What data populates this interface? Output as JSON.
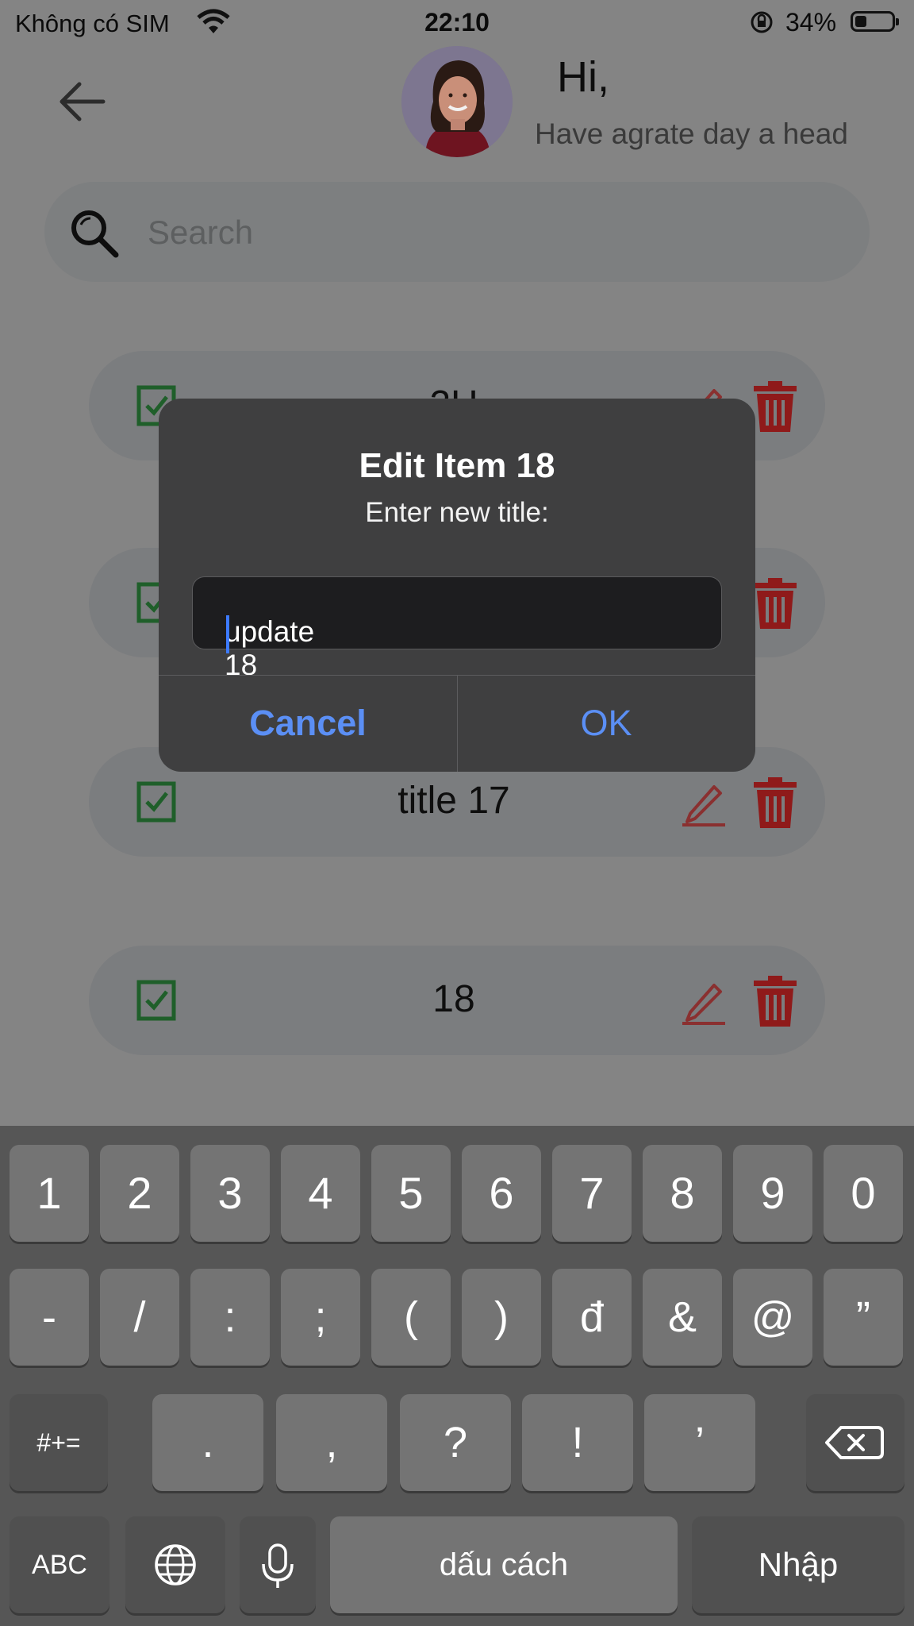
{
  "status_bar": {
    "carrier": "Không có SIM",
    "time": "22:10",
    "battery": "34%"
  },
  "header": {
    "greeting": "Hi,",
    "subtitle": "Have agrate day a head"
  },
  "search": {
    "placeholder": "Search"
  },
  "list": {
    "items": [
      {
        "title": "2H"
      },
      {
        "title": ""
      },
      {
        "title": "title 17"
      },
      {
        "title": "18"
      }
    ]
  },
  "dialog": {
    "title": "Edit Item 18",
    "message": "Enter new title:",
    "input_value": "update 18",
    "cancel_label": "Cancel",
    "ok_label": "OK"
  },
  "keyboard": {
    "row1": [
      "1",
      "2",
      "3",
      "4",
      "5",
      "6",
      "7",
      "8",
      "9",
      "0"
    ],
    "row2": [
      "-",
      "/",
      ":",
      ";",
      "(",
      ")",
      "đ",
      "&",
      "@",
      "”"
    ],
    "row3": [
      ".",
      ",",
      "?",
      "!",
      "’"
    ],
    "shift_label": "#+=",
    "abc_label": "ABC",
    "space_label": "dấu cách",
    "return_label": "Nhập"
  },
  "colors": {
    "check_green": "#1f5f2a",
    "edit_red": "#8a3030",
    "delete_red": "#8f1a1a",
    "dialog_button_blue": "#5b8ff5",
    "caret_blue": "#3d7bff"
  }
}
